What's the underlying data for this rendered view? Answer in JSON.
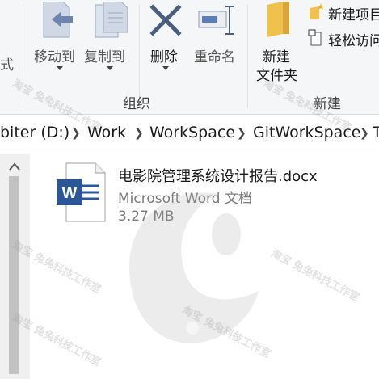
{
  "ribbon": {
    "partial_left_label": "式",
    "organize": {
      "move_to": "移动到",
      "copy_to": "复制到",
      "delete": "删除",
      "rename": "重命名",
      "group_label": "组织"
    },
    "new": {
      "new_folder_line1": "新建",
      "new_folder_line2": "文件夹",
      "new_item": "新建项目",
      "easy_access": "轻松访问",
      "group_label": "新建"
    }
  },
  "address_bar": {
    "crumbs": [
      "biter (D:)",
      "Work",
      "WorkSpace",
      "GitWorkSpace",
      "T"
    ]
  },
  "file": {
    "name": "电影院管理系统设计报告.docx",
    "type": "Microsoft Word 文档",
    "size": "3.27 MB"
  },
  "watermark": {
    "text": "淘宝 兔兔科技工作室"
  },
  "colors": {
    "ribbon_bg": "#f5f6f7",
    "word_blue": "#2b579a",
    "delete_x": "#2b579a",
    "folder_yellow": "#e8b33a",
    "muted_text": "#7a7a7a"
  }
}
